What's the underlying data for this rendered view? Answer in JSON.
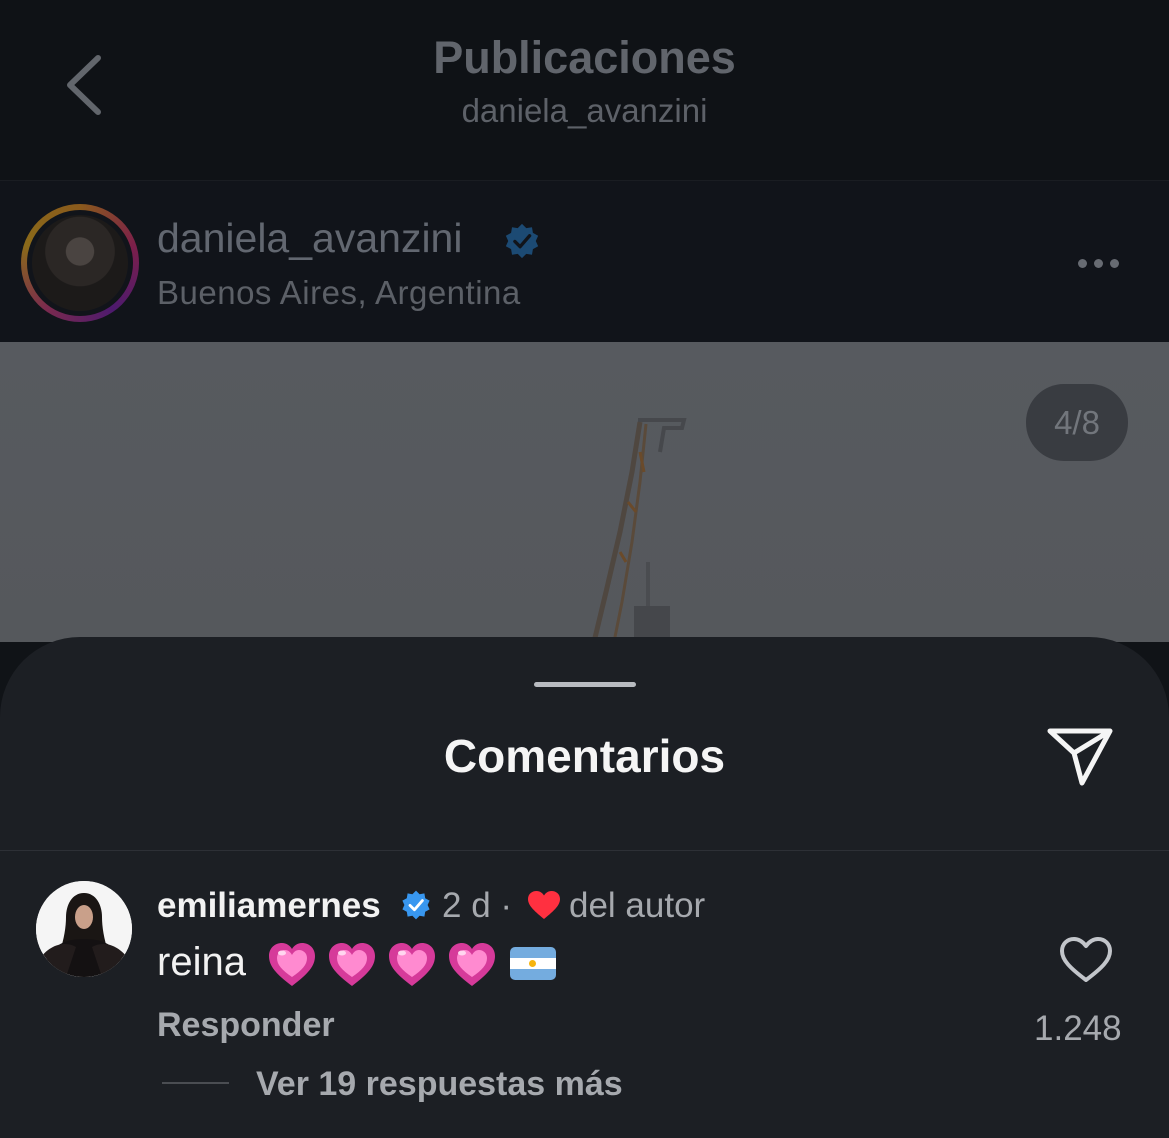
{
  "header": {
    "title": "Publicaciones",
    "subtitle": "daniela_avanzini"
  },
  "post": {
    "username": "daniela_avanzini",
    "location": "Buenos Aires, Argentina",
    "media_counter": "4/8"
  },
  "comments_sheet": {
    "title": "Comentarios",
    "comment": {
      "username": "emiliamernes",
      "time": "2 d ·",
      "liked_by_author": "del autor",
      "text": "reina",
      "emojis": [
        "pink-heart",
        "pink-heart",
        "pink-heart",
        "pink-heart",
        "argentina-flag"
      ],
      "reply_label": "Responder",
      "like_count": "1.248",
      "view_replies": "Ver 19 respuestas más"
    }
  },
  "colors": {
    "verified": "#3897f0",
    "heart_red": "#ff3040",
    "sheet_bg": "#1c1f24",
    "overlay_bg": "#101317"
  }
}
